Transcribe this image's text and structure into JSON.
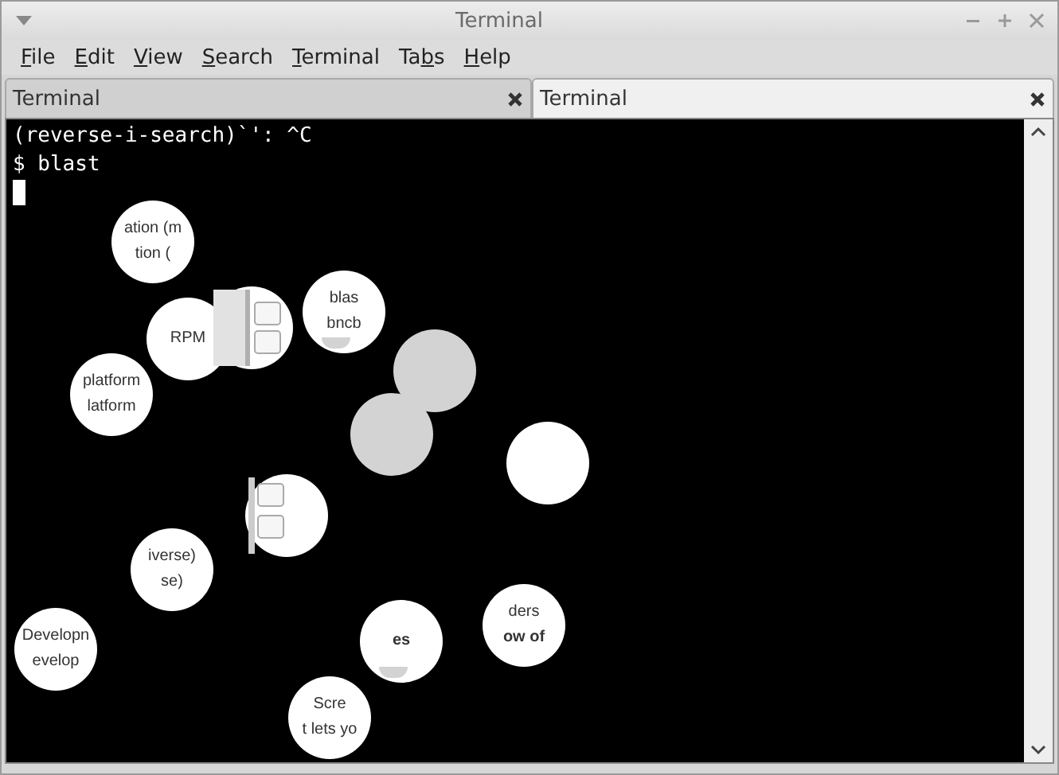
{
  "window": {
    "title": "Terminal"
  },
  "menu": [
    {
      "label": "File"
    },
    {
      "label": "Edit"
    },
    {
      "label": "View"
    },
    {
      "label": "Search"
    },
    {
      "label": "Terminal"
    },
    {
      "label": "Tabs"
    },
    {
      "label": "Help"
    }
  ],
  "tabs": [
    {
      "label": "Terminal",
      "selected": false
    },
    {
      "label": "Terminal",
      "selected": true
    }
  ],
  "terminal": {
    "lines": [
      "(reverse-i-search)`': ^C",
      "$ blast"
    ],
    "cursor": true
  },
  "glitch_spots": [
    {
      "kind": "text",
      "lines": [
        {
          "text": "ation (m",
          "bold": false
        },
        {
          "text": "tion (",
          "bold": false
        }
      ]
    },
    {
      "kind": "text",
      "lines": [
        {
          "text": "RPM",
          "bold": false
        }
      ]
    },
    {
      "kind": "scrollbar"
    },
    {
      "kind": "text",
      "lines": [
        {
          "text": "blas",
          "bold": false
        },
        {
          "text": "bncb",
          "bold": false
        }
      ],
      "wedge": true
    },
    {
      "kind": "grey"
    },
    {
      "kind": "grey"
    },
    {
      "kind": "text",
      "lines": [
        {
          "text": "platform",
          "bold": false
        },
        {
          "text": "latform",
          "bold": false
        }
      ]
    },
    {
      "kind": "blank"
    },
    {
      "kind": "buttons"
    },
    {
      "kind": "text",
      "lines": [
        {
          "text": "iverse)",
          "bold": false
        },
        {
          "text": "se)",
          "bold": false
        }
      ]
    },
    {
      "kind": "text",
      "lines": [
        {
          "text": "Developn",
          "bold": false
        },
        {
          "text": "evelop",
          "bold": false
        }
      ]
    },
    {
      "kind": "text",
      "lines": [
        {
          "text": "es",
          "bold": true
        }
      ],
      "wedge": true
    },
    {
      "kind": "text",
      "lines": [
        {
          "text": "ders",
          "bold": false
        },
        {
          "text": "ow of",
          "bold": true
        }
      ]
    },
    {
      "kind": "text",
      "lines": [
        {
          "text": "Scre",
          "bold": false
        },
        {
          "text": "t lets yo",
          "bold": false
        }
      ]
    }
  ]
}
